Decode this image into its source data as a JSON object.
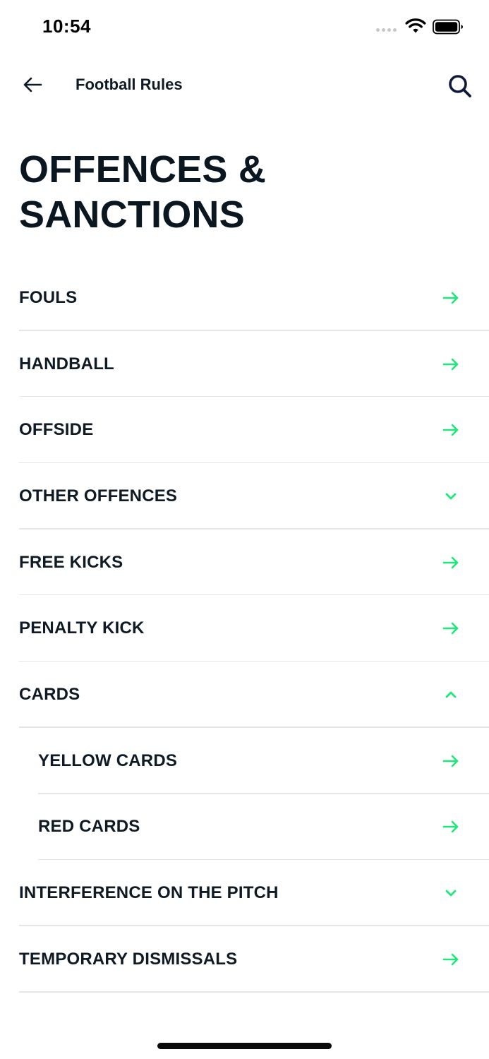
{
  "status_bar": {
    "time": "10:54"
  },
  "nav": {
    "title": "Football Rules",
    "back_icon": "arrow-left-icon",
    "search_icon": "search-icon"
  },
  "page": {
    "title": "OFFENCES & SANCTIONS"
  },
  "colors": {
    "accent": "#1ee87a",
    "text": "#0f1a24",
    "divider": "#e3e6e8"
  },
  "items": [
    {
      "label": "FOULS",
      "icon": "arrow-right-icon",
      "level": 0
    },
    {
      "label": "HANDBALL",
      "icon": "arrow-right-icon",
      "level": 0
    },
    {
      "label": "OFFSIDE",
      "icon": "arrow-right-icon",
      "level": 0
    },
    {
      "label": "OTHER OFFENCES",
      "icon": "chevron-down-icon",
      "level": 0
    },
    {
      "label": "FREE KICKS",
      "icon": "arrow-right-icon",
      "level": 0
    },
    {
      "label": "PENALTY KICK",
      "icon": "arrow-right-icon",
      "level": 0
    },
    {
      "label": "CARDS",
      "icon": "chevron-up-icon",
      "level": 0
    },
    {
      "label": "YELLOW CARDS",
      "icon": "arrow-right-icon",
      "level": 1
    },
    {
      "label": "RED CARDS",
      "icon": "arrow-right-icon",
      "level": 1
    },
    {
      "label": "INTERFERENCE ON THE PITCH",
      "icon": "chevron-down-icon",
      "level": 0
    },
    {
      "label": "TEMPORARY DISMISSALS",
      "icon": "arrow-right-icon",
      "level": 0
    }
  ]
}
